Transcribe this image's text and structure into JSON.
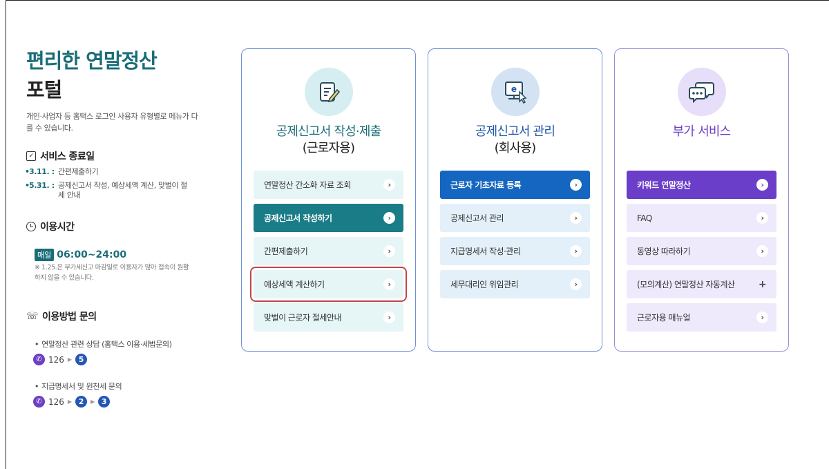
{
  "left": {
    "title_line1": "편리한 연말정산",
    "title_line2": "포털",
    "description": "개인·사업자 등 홈택스 로그인 사용자 유형별로 메뉴가 다를 수 있습니다.",
    "service_end": {
      "heading": "서비스 종료일",
      "icon": "check-calendar-icon",
      "items": [
        {
          "date": "3.11. :",
          "text": "간편제출하기"
        },
        {
          "date": "5.31. :",
          "text": "공제신고서 작성, 예상세액 계산, 맞벌이 절세 안내"
        }
      ]
    },
    "usage_time": {
      "heading": "이용시간",
      "icon": "clock-icon",
      "badge": "매일",
      "time": "06:00~24:00",
      "note": "※ 1.25.은 부가세신고 마감일로 이용자가 많아 접속이 원활하지 않을 수 있습니다."
    },
    "inquiry": {
      "heading": "이용방법 문의",
      "icon": "phone-icon",
      "items": [
        {
          "text": "연말정산 관련 상담 (홈택스 이용·세법문의)",
          "number": "126",
          "steps": [
            "5"
          ]
        },
        {
          "text": "지급명세서 및 원천세 문의",
          "number": "126",
          "steps": [
            "2",
            "3"
          ]
        }
      ]
    }
  },
  "cards": [
    {
      "icon": "document-edit-icon",
      "title_line1": "공제신고서 작성·제출",
      "title_line2": "(근로자용)",
      "buttons": [
        {
          "label": "연말정산 간소화 자료 조회",
          "active": false,
          "mark": "›"
        },
        {
          "label": "공제신고서 작성하기",
          "active": true,
          "mark": "›"
        },
        {
          "label": "간편제출하기",
          "active": false,
          "mark": "›"
        },
        {
          "label": "예상세액 계산하기",
          "active": false,
          "mark": "›"
        },
        {
          "label": "맞벌이 근로자 절세안내",
          "active": false,
          "mark": "›"
        }
      ]
    },
    {
      "icon": "e-computer-icon",
      "title_line1": "공제신고서 관리",
      "title_line2": "(회사용)",
      "buttons": [
        {
          "label": "근로자 기초자료 등록",
          "active": true,
          "mark": "›"
        },
        {
          "label": "공제신고서 관리",
          "active": false,
          "mark": "›"
        },
        {
          "label": "지급명세서 작성·관리",
          "active": false,
          "mark": "›"
        },
        {
          "label": "세무대리인 위임관리",
          "active": false,
          "mark": "›"
        }
      ]
    },
    {
      "icon": "chat-bubbles-icon",
      "title_line1": "부가 서비스",
      "title_line2": "",
      "buttons": [
        {
          "label": "키워드 연말정산",
          "active": true,
          "mark": "›"
        },
        {
          "label": "FAQ",
          "active": false,
          "mark": "›"
        },
        {
          "label": "동영상 따라하기",
          "active": false,
          "mark": "›"
        },
        {
          "label": "(모의계산) 연말정산 자동계산",
          "active": false,
          "mark": "+"
        },
        {
          "label": "근로자용 매뉴얼",
          "active": false,
          "mark": "›"
        }
      ]
    }
  ],
  "colors": {
    "teal": "#1a7c87",
    "blue": "#1566c0",
    "purple": "#6a3ec8",
    "highlight_border": "#c0454a"
  }
}
